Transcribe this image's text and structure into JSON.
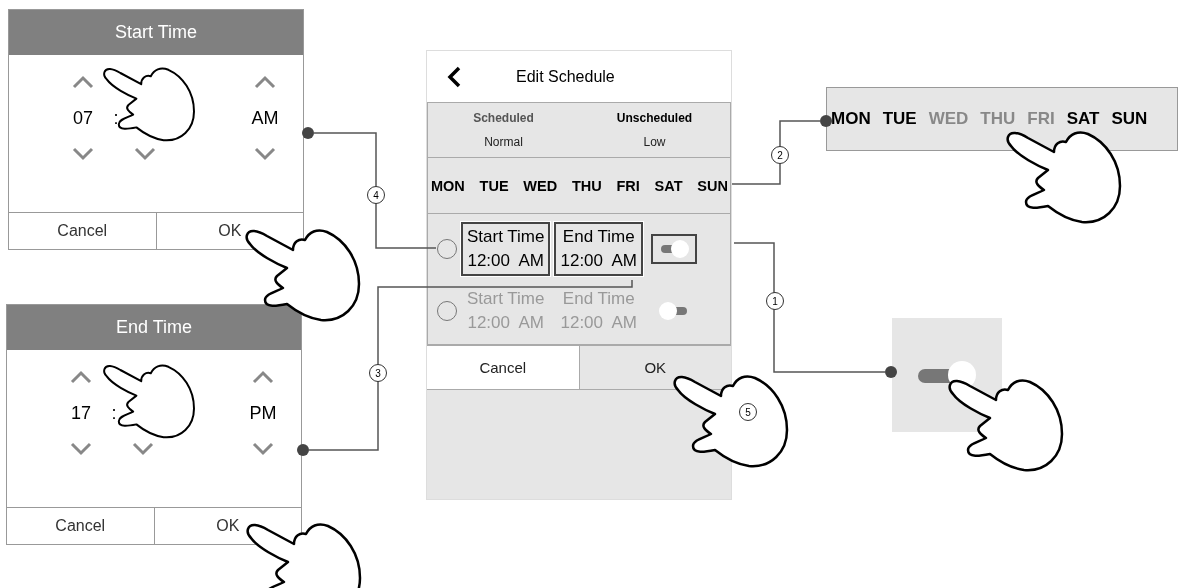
{
  "start_time_dialog": {
    "title": "Start Time",
    "hour": "07",
    "separator": ":",
    "period": "AM",
    "buttons": [
      "Cancel",
      "OK"
    ]
  },
  "end_time_dialog": {
    "title": "End Time",
    "hour": "17",
    "separator": ":",
    "period": "PM",
    "buttons": [
      "Cancel",
      "OK"
    ]
  },
  "edit_schedule": {
    "title": "Edit Schedule",
    "modes": [
      {
        "label": "Scheduled",
        "level_name": "Normal",
        "selected": false
      },
      {
        "label": "Unscheduled",
        "level_name": "Low",
        "selected": true
      }
    ],
    "days": [
      {
        "label": "MON",
        "selected": true
      },
      {
        "label": "TUE",
        "selected": true
      },
      {
        "label": "WED",
        "selected": true
      },
      {
        "label": "THU",
        "selected": true
      },
      {
        "label": "FRI",
        "selected": true
      },
      {
        "label": "SAT",
        "selected": true
      },
      {
        "label": "SUN",
        "selected": true
      }
    ],
    "slots": [
      {
        "start_label": "Start Time",
        "start_value": "12:00  AM",
        "end_label": "End Time",
        "end_value": "12:00  AM",
        "selected": false,
        "on": true,
        "highlighted": true
      },
      {
        "start_label": "Start Time",
        "start_value": "12:00  AM",
        "end_label": "End Time",
        "end_value": "12:00  AM",
        "selected": false,
        "on": false,
        "highlighted": false
      }
    ],
    "buttons": [
      {
        "label": "Cancel",
        "highlighted": false
      },
      {
        "label": "OK",
        "highlighted": true
      }
    ]
  },
  "day_strip": {
    "days": [
      {
        "label": "MON",
        "selected": true
      },
      {
        "label": "TUE",
        "selected": true
      },
      {
        "label": "WED",
        "selected": false
      },
      {
        "label": "THU",
        "selected": false
      },
      {
        "label": "FRI",
        "selected": false
      },
      {
        "label": "SAT",
        "selected": true
      },
      {
        "label": "SUN",
        "selected": true
      }
    ]
  },
  "toggle_panel": {
    "on": true
  },
  "callouts": [
    "1",
    "2",
    "3",
    "4",
    "5"
  ]
}
